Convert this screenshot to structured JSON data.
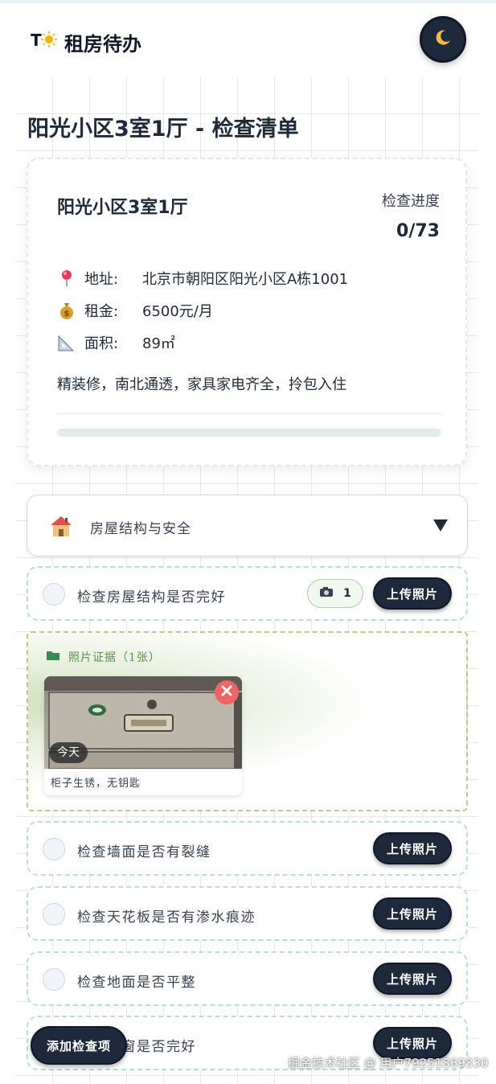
{
  "header": {
    "logo_icon": "tasks-sun-logo-icon",
    "app_title": "租房待办",
    "theme_toggle_icon": "moon-icon"
  },
  "page": {
    "title": "阳光小区3室1厅 - 检查清单"
  },
  "property": {
    "name": "阳光小区3室1厅",
    "progress_label": "检查进度",
    "progress_count": "0/73",
    "progress_fraction": 0,
    "address_icon": "pin-icon",
    "address_label": "地址:",
    "address_value": "北京市朝阳区阳光小区A栋1001",
    "rent_icon": "money-bag-icon",
    "rent_label": "租金:",
    "rent_value": "6500元/月",
    "area_icon": "ruler-icon",
    "area_label": "面积:",
    "area_value": "89㎡",
    "description": "精装修，南北通透，家具家电齐全，拎包入住"
  },
  "category": {
    "icon": "house-icon",
    "label": "房屋结构与安全",
    "toggle_icon": "chevron-down-icon"
  },
  "items": [
    {
      "label": "检查房屋结构是否完好",
      "photo_count": "1",
      "upload_label": "上传照片"
    },
    {
      "label": "检查墙面是否有裂缝",
      "upload_label": "上传照片"
    },
    {
      "label": "检查天花板是否有渗水痕迹",
      "upload_label": "上传照片"
    },
    {
      "label": "检查地面是否平整",
      "upload_label": "上传照片"
    },
    {
      "label": "检查门窗是否完好",
      "upload_label": "上传照片"
    }
  ],
  "evidence": {
    "title": "照片证据（1张）",
    "folder_icon": "folder-icon",
    "photo": {
      "date_badge": "今天",
      "caption": "柜子生锈，无钥匙"
    }
  },
  "fab": {
    "label": "添加检查项"
  },
  "watermark": "掘金技术社区 @ 用户79251869330",
  "colors": {
    "dark_button": "#1e293b",
    "item_border": "#b7dfd0",
    "evidence_border": "#b8c98b",
    "progress_track": "#e0ede6",
    "delete_red": "#ef6464"
  }
}
